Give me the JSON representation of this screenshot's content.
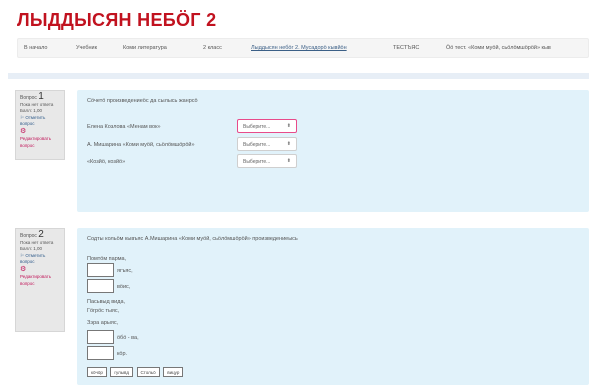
{
  "page": {
    "title": "ЛЫДДЫСЯН НЕБӦГ 2"
  },
  "breadcrumb": [
    {
      "label": "В начало",
      "link": false
    },
    {
      "label": "Учебник",
      "link": false
    },
    {
      "label": "Коми литература",
      "link": false
    },
    {
      "label": "2 класс",
      "link": false
    },
    {
      "label": "Лыддысян небӧг 2. Мусадорӧ кывйӧн",
      "link": true
    },
    {
      "label": "ТЕСТЪЯС",
      "link": false
    },
    {
      "label": "Ӧӧ тест. «Коми муӧй, сьӧлӧмшӧрӧй» кыв",
      "link": false
    }
  ],
  "questions": [
    {
      "label": "Вопрос",
      "number": "1",
      "status": "Пока нет ответа",
      "score": "Балл: 1,00",
      "flag": "Отметить вопрос",
      "edit": "Редактировать вопрос",
      "prompt": "Сӧчетӧ произведениеӧс да сылысь жанрсӧ",
      "rows": [
        {
          "text": "Елена Козлова «Менам вок»",
          "select": "Выберите...",
          "active": true
        },
        {
          "text": "А. Мишарина «Коми муӧй, сьӧлӧмшӧрӧй»",
          "select": "Выберите...",
          "active": false
        },
        {
          "text": "«Козйӧ, козйӧ»",
          "select": "Выберите...",
          "active": false
        }
      ]
    },
    {
      "label": "Вопрос",
      "number": "2",
      "status": "Пока нет ответа",
      "score": "Балл: 1,00",
      "flag": "Отметить вопрос",
      "edit": "Редактировать вопрос",
      "prompt": "Содты кольӧм кывъяс А.Мишарина «Коми муӧй, сьӧлӧмшӧрӧй» произведениеысь",
      "lines": {
        "l1": "Помтӧм парма,",
        "b1": "ягъяс,",
        "b2": "вӧис,",
        "l2": "Пасьвыд вида,",
        "l3": "Гӧгрӧс тыяс,",
        "l4": "Зэра арыяс,",
        "b3": "ӧбӧ - ва,",
        "b4": "кӧр."
      },
      "chips": [
        "кӧчӧр",
        "гулывд",
        "Стольӧ",
        "вицур"
      ]
    }
  ]
}
